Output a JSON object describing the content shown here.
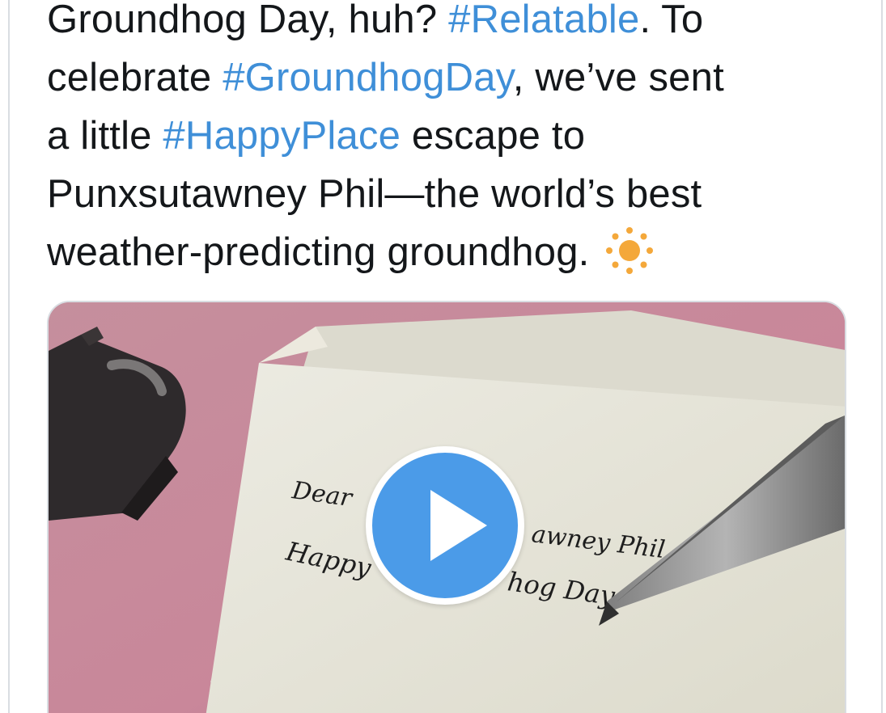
{
  "tweet": {
    "lines": [
      [
        {
          "text": "Groundhog Day, huh? "
        },
        {
          "text": "#Relatable",
          "hashtag": true
        },
        {
          "text": ". To"
        }
      ],
      [
        {
          "text": "celebrate "
        },
        {
          "text": "#GroundhogDay",
          "hashtag": true
        },
        {
          "text": ", we’ve sent"
        }
      ],
      [
        {
          "text": "a little "
        },
        {
          "text": "#HappyPlace",
          "hashtag": true
        },
        {
          "text": " escape to"
        }
      ],
      [
        {
          "text": "Punxsutawney Phil—the world’s best"
        }
      ],
      [
        {
          "text": "weather-predicting groundhog. "
        }
      ]
    ],
    "emoji": "sun-icon",
    "hashtag_color": "#3f8fd8",
    "text_color": "#14171a"
  },
  "media": {
    "type": "video",
    "play_icon": "play-icon",
    "play_color": "#4b9be8",
    "note_line1_left": "Dear",
    "note_line1_right": "awney Phil",
    "note_line2_left": "Happy",
    "note_line2_right": "hog Day"
  }
}
